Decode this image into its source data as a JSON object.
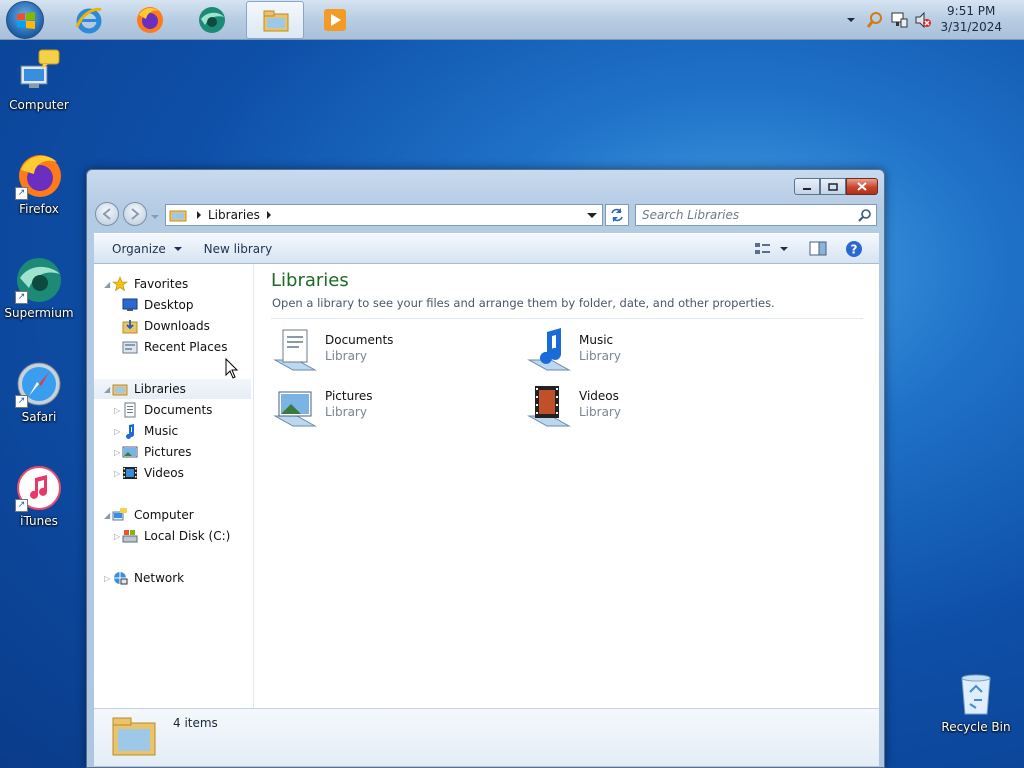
{
  "taskbar": {
    "apps": [
      {
        "name": "Internet Explorer"
      },
      {
        "name": "Firefox"
      },
      {
        "name": "Supermium"
      },
      {
        "name": "Windows Explorer",
        "active": true
      },
      {
        "name": "Media Player"
      }
    ],
    "clock": {
      "time": "9:51 PM",
      "date": "3/31/2024"
    }
  },
  "desktop": {
    "icons": [
      {
        "label": "Computer",
        "icon": "computer-icon"
      },
      {
        "label": "Firefox",
        "icon": "firefox-icon"
      },
      {
        "label": "Supermium",
        "icon": "supermium-icon"
      },
      {
        "label": "Safari",
        "icon": "safari-icon"
      },
      {
        "label": "iTunes",
        "icon": "itunes-icon"
      },
      {
        "label": "Recycle Bin",
        "icon": "recycle-bin-icon"
      }
    ]
  },
  "explorer": {
    "address": {
      "crumb": "Libraries"
    },
    "search": {
      "placeholder": "Search Libraries"
    },
    "toolbar": {
      "organize": "Organize",
      "new_library": "New library"
    },
    "nav": {
      "favorites": "Favorites",
      "desktop": "Desktop",
      "downloads": "Downloads",
      "recent": "Recent Places",
      "libraries": "Libraries",
      "documents": "Documents",
      "music": "Music",
      "pictures": "Pictures",
      "videos": "Videos",
      "computer": "Computer",
      "local_disk": "Local Disk (C:)",
      "network": "Network"
    },
    "content": {
      "title": "Libraries",
      "subtitle": "Open a library to see your files and arrange them by folder, date, and other properties.",
      "libraries": [
        {
          "name": "Documents",
          "kind": "Library"
        },
        {
          "name": "Music",
          "kind": "Library"
        },
        {
          "name": "Pictures",
          "kind": "Library"
        },
        {
          "name": "Videos",
          "kind": "Library"
        }
      ]
    },
    "details": {
      "count": "4 items"
    }
  },
  "colors": {
    "title_green": "#1e6a25",
    "close_red": "#c8452c"
  }
}
